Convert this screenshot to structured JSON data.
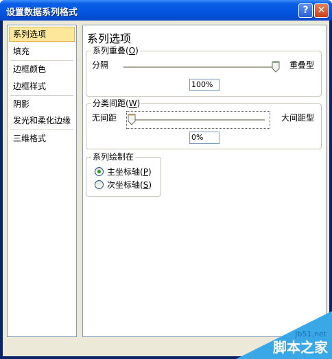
{
  "window": {
    "title": "设置数据系列格式",
    "help_symbol": "?",
    "close_symbol": "✕"
  },
  "sidebar": {
    "items": [
      {
        "label": "系列选项",
        "selected": true
      },
      {
        "label": "填充",
        "selected": false
      },
      {
        "label": "边框颜色",
        "selected": false
      },
      {
        "label": "边框样式",
        "selected": false
      },
      {
        "label": "阴影",
        "selected": false
      },
      {
        "label": "发光和柔化边缘",
        "selected": false
      },
      {
        "label": "三维格式",
        "selected": false
      }
    ]
  },
  "main": {
    "title": "系列选项",
    "overlap": {
      "group_label": "系列重叠",
      "accesskey": "O",
      "left_label": "分隔",
      "right_label": "重叠型",
      "value": "100%",
      "level": 1.0
    },
    "gap": {
      "group_label": "分类间距",
      "accesskey": "W",
      "left_label": "无间距",
      "right_label": "大间距型",
      "value": "0%",
      "level": 0.0
    },
    "plot_on": {
      "group_label": "系列绘制在",
      "options": [
        {
          "label": "主坐标轴",
          "accesskey": "P",
          "selected": true
        },
        {
          "label": "次坐标轴",
          "accesskey": "S",
          "selected": false
        }
      ]
    }
  },
  "watermark": {
    "site": "jb51.net",
    "name": "脚本之家"
  }
}
